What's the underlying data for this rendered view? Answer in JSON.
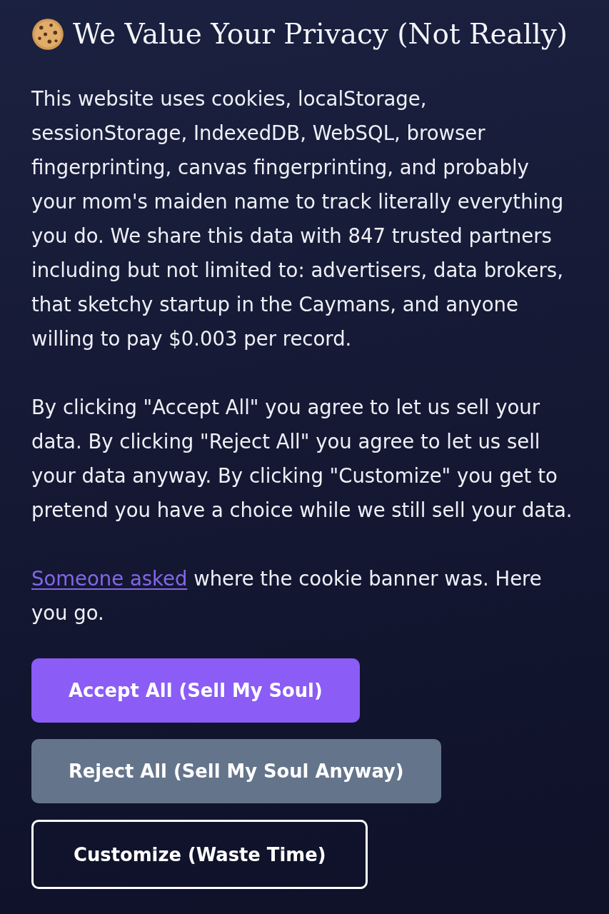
{
  "title": "We Value Your Privacy (Not Really)",
  "paragraphs": [
    {
      "kind": "plain",
      "text": "This website uses cookies, localStorage, sessionStorage, IndexedDB, WebSQL, browser fingerprinting, canvas fingerprinting, and probably your mom's maiden name to track literally everything you do. We share this data with 847 trusted partners including but not limited to: advertisers, data brokers, that sketchy startup in the Caymans, and anyone willing to pay $0.003 per record."
    },
    {
      "kind": "plain",
      "text": "By clicking \"Accept All\" you agree to let us sell your data. By clicking \"Reject All\" you agree to let us sell your data anyway. By clicking \"Customize\" you get to pretend you have a choice while we still sell your data."
    },
    {
      "kind": "link",
      "link": "Someone asked",
      "text": " where the cookie banner was. Here you go."
    }
  ],
  "buttons": [
    {
      "kind": "primary",
      "label": "Accept All (Sell My Soul)"
    },
    {
      "kind": "secondary",
      "label": "Reject All (Sell My Soul Anyway)"
    },
    {
      "kind": "outline",
      "label": "Customize (Waste Time)"
    }
  ]
}
